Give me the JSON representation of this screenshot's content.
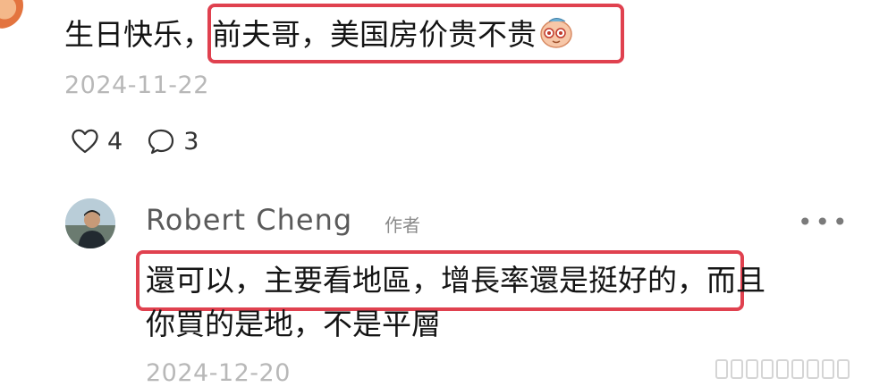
{
  "top_comment": {
    "prefix": "生日快乐，",
    "highlighted": "前夫哥，美国房价贵不贵",
    "emoji": "shy-face-emoji",
    "date": "2024-11-22",
    "likes": "4",
    "replies": "3"
  },
  "reply": {
    "name": "Robert Cheng",
    "author_tag": "作者",
    "more": "…",
    "highlighted": "還可以，主要看地區，增長率還是挺好的，",
    "line1_rest": "而且",
    "line2": "你買的是地，不是平層",
    "date": "2024-12-20"
  },
  "colors": {
    "highlight_border": "#e0414f",
    "date_text": "#b8b8b8"
  }
}
